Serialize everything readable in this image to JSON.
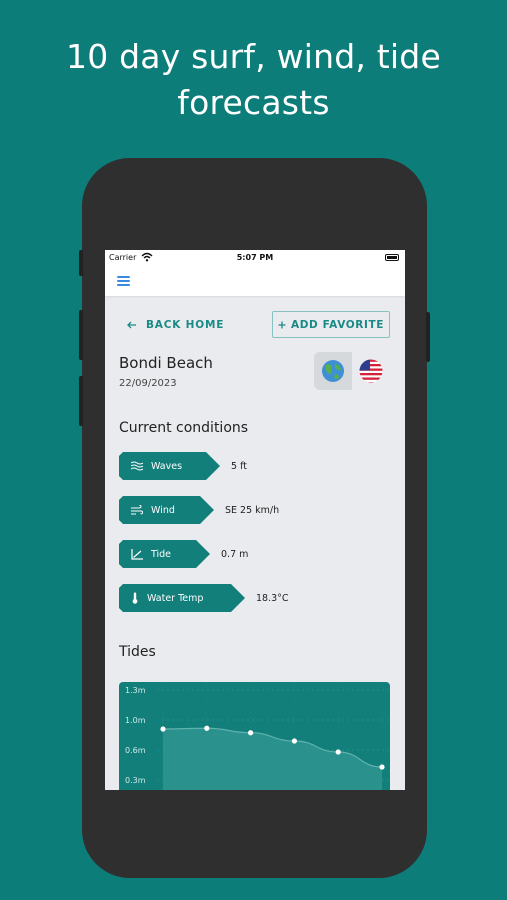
{
  "headline": {
    "line1": "10 day surf, wind, tide",
    "line2": "forecasts"
  },
  "status_bar": {
    "carrier": "Carrier",
    "time": "5:07 PM"
  },
  "navbar": {
    "menu_icon": "hamburger-menu-icon"
  },
  "actions": {
    "back_home": "BACK HOME",
    "back_icon": "arrow-left-icon",
    "add_favorite": "ADD FAVORITE",
    "add_icon": "plus-icon"
  },
  "location": {
    "name": "Bondi Beach",
    "date": "22/09/2023",
    "globe_icon": "globe-icon",
    "flag_icon": "us-flag-icon"
  },
  "current_conditions": {
    "title": "Current conditions",
    "items": [
      {
        "label": "Waves",
        "value": "5 ft",
        "icon": "waves-icon"
      },
      {
        "label": "Wind",
        "value": "SE 25 km/h",
        "icon": "wind-icon"
      },
      {
        "label": "Tide",
        "value": "0.7 m",
        "icon": "tide-chart-icon"
      },
      {
        "label": "Water Temp",
        "value": "18.3°C",
        "icon": "thermometer-icon"
      }
    ]
  },
  "tides": {
    "title": "Tides"
  },
  "chart_data": {
    "type": "area",
    "title": "",
    "xlabel": "",
    "ylabel": "",
    "y_ticks": [
      "1.3m",
      "1.0m",
      "0.6m",
      "0.3m"
    ],
    "ylim": [
      0.3,
      1.3
    ],
    "x": [
      1,
      2,
      3,
      4,
      5,
      6
    ],
    "values": [
      0.88,
      0.89,
      0.83,
      0.72,
      0.58,
      0.43
    ],
    "grid": true,
    "colors": {
      "background": "#127f7b",
      "fill": "#2e948f",
      "line": "#5fb3ae",
      "points": "#ffffff"
    }
  },
  "colors": {
    "background": "#0d7d7a",
    "accent": "#127f7b",
    "link": "#1a8a86",
    "menu": "#3a8be0"
  }
}
